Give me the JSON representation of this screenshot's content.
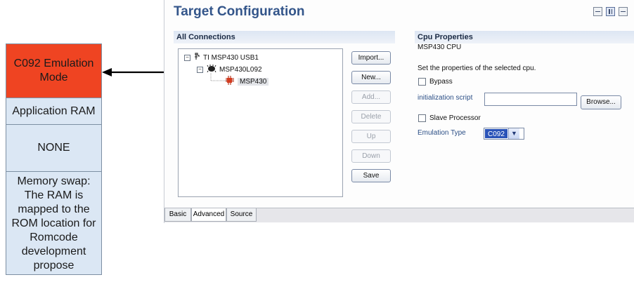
{
  "emulation_mode": {
    "title": "C092 Emulation Mode",
    "application_ram": "Application RAM",
    "none": "NONE",
    "note": "Memory swap: The RAM is mapped to the ROM location for Romcode development propose"
  },
  "colors": {
    "accent_red": "#ef4422",
    "light_blue": "#dbe7f4",
    "title_blue": "#33558a"
  },
  "panel": {
    "title": "Target Configuration"
  },
  "connections": {
    "header": "All Connections",
    "tree": [
      {
        "label": "TI MSP430 USB1",
        "icon": "usb-probe-icon"
      },
      {
        "label": "MSP430L092",
        "icon": "chip-icon"
      },
      {
        "label": "MSP430",
        "icon": "cpu-icon"
      }
    ],
    "buttons": {
      "import": "Import...",
      "new": "New...",
      "add": "Add...",
      "delete": "Delete",
      "up": "Up",
      "down": "Down",
      "save": "Save"
    }
  },
  "cpu": {
    "header": "Cpu Properties",
    "name": "MSP430 CPU",
    "description": "Set the properties of the selected cpu.",
    "bypass": "Bypass",
    "init_script_label": "initialization script",
    "init_script_value": "",
    "browse": "Browse...",
    "slave": "Slave Processor",
    "emulation_type_label": "Emulation Type",
    "emulation_type_value": "C092"
  },
  "tabs": [
    "Basic",
    "Advanced",
    "Source"
  ]
}
